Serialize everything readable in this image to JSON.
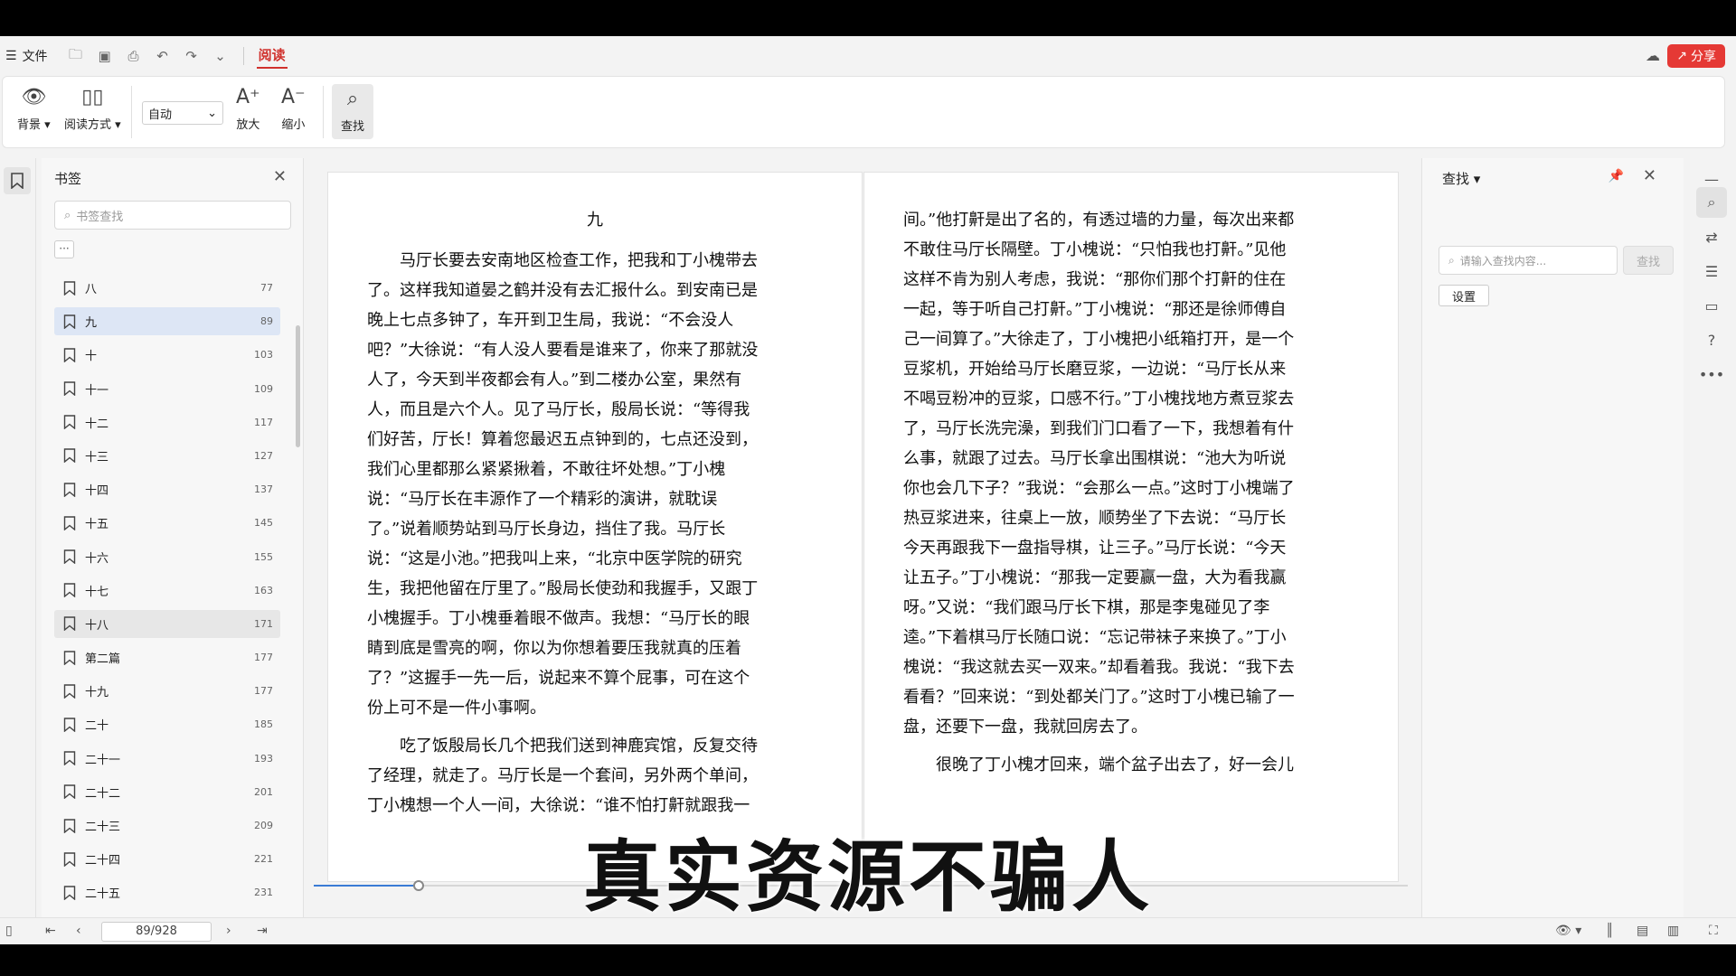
{
  "menubar": {
    "file_label": "文件",
    "active_tab": "阅读",
    "share_label": "分享"
  },
  "ribbon": {
    "background_label": "背景",
    "read_mode_label": "阅读方式",
    "zoom_select_value": "自动",
    "zoom_in_label": "放大",
    "zoom_out_label": "缩小",
    "find_label": "查找"
  },
  "bookmarks": {
    "title": "书签",
    "search_placeholder": "书签查找",
    "more_label": "···",
    "items": [
      {
        "name": "八",
        "page": "77"
      },
      {
        "name": "九",
        "page": "89"
      },
      {
        "name": "十",
        "page": "103"
      },
      {
        "name": "十一",
        "page": "109"
      },
      {
        "name": "十二",
        "page": "117"
      },
      {
        "name": "十三",
        "page": "127"
      },
      {
        "name": "十四",
        "page": "137"
      },
      {
        "name": "十五",
        "page": "145"
      },
      {
        "name": "十六",
        "page": "155"
      },
      {
        "name": "十七",
        "page": "163"
      },
      {
        "name": "十八",
        "page": "171"
      },
      {
        "name": "第二篇",
        "page": "177"
      },
      {
        "name": "十九",
        "page": "177"
      },
      {
        "name": "二十",
        "page": "185"
      },
      {
        "name": "二十一",
        "page": "193"
      },
      {
        "name": "二十二",
        "page": "201"
      },
      {
        "name": "二十三",
        "page": "209"
      },
      {
        "name": "二十四",
        "page": "221"
      },
      {
        "name": "二十五",
        "page": "231"
      }
    ],
    "active_index": 1,
    "hover_index": 10
  },
  "document": {
    "left_page": {
      "chapter": "九",
      "paragraphs": [
        "马厅长要去安南地区检查工作，把我和丁小槐带去了。这样我知道晏之鹤并没有去汇报什么。到安南已是晚上七点多钟了，车开到卫生局，我说：“不会没人吧？”大徐说：“有人没人要看是谁来了，你来了那就没人了，今天到半夜都会有人。”到二楼办公室，果然有人，而且是六个人。见了马厅长，殷局长说：“等得我们好苦，厅长！算着您最迟五点钟到的，七点还没到，我们心里都那么紧紧揪着，不敢往坏处想。”丁小槐说：“马厅长在丰源作了一个精彩的演讲，就耽误了。”说着顺势站到马厅长身边，挡住了我。马厅长说：“这是小池。”把我叫上来，“北京中医学院的研究生，我把他留在厅里了。”殷局长使劲和我握手，又跟丁小槐握手。丁小槐垂着眼不做声。我想：“马厅长的眼睛到底是雪亮的啊，你以为你想着要压我就真的压着了？”这握手一先一后，说起来不算个屁事，可在这个份上可不是一件小事啊。",
        "吃了饭殷局长几个把我们送到神鹿宾馆，反复交待了经理，就走了。马厅长是一个套间，另外两个单间，丁小槐想一个人一间，大徐说：“谁不怕打鼾就跟我一"
      ]
    },
    "right_page": {
      "paragraphs": [
        "间。”他打鼾是出了名的，有透过墙的力量，每次出来都不敢住马厅长隔壁。丁小槐说：“只怕我也打鼾。”见他这样不肯为别人考虑，我说：“那你们那个打鼾的住在一起，等于听自己打鼾。”丁小槐说：“那还是徐师傅自己一间算了。”大徐走了，丁小槐把小纸箱打开，是一个豆浆机，开始给马厅长磨豆浆，一边说：“马厅长从来不喝豆粉冲的豆浆，口感不行。”丁小槐找地方煮豆浆去了，马厅长洗完澡，到我们门口看了一下，我想着有什么事，就跟了过去。马厅长拿出围棋说：“池大为听说你也会几下子？”我说：“会那么一点。”这时丁小槐端了热豆浆进来，往桌上一放，顺势坐了下去说：“马厅长今天再跟我下一盘指导棋，让三子。”马厅长说：“今天让五子。”丁小槐说：“那我一定要赢一盘，大为看我赢呀。”又说：“我们跟马厅长下棋，那是李鬼碰见了李逵。”下着棋马厅长随口说：“忘记带袜子来换了。”丁小槐说：“我这就去买一双来。”却看着我。我说：“我下去看看？”回来说：“到处都关门了。”这时丁小槐已输了一盘，还要下一盘，我就回房去了。",
        "很晚了丁小槐才回来，端个盆子出去了，好一会儿"
      ]
    },
    "progress_fraction": 0.096
  },
  "find": {
    "title": "查找",
    "input_placeholder": "请输入查找内容...",
    "search_button": "查找",
    "settings_button": "设置"
  },
  "statusbar": {
    "page_indicator": "89/928"
  },
  "overlay_text": "真实资源不骗人"
}
